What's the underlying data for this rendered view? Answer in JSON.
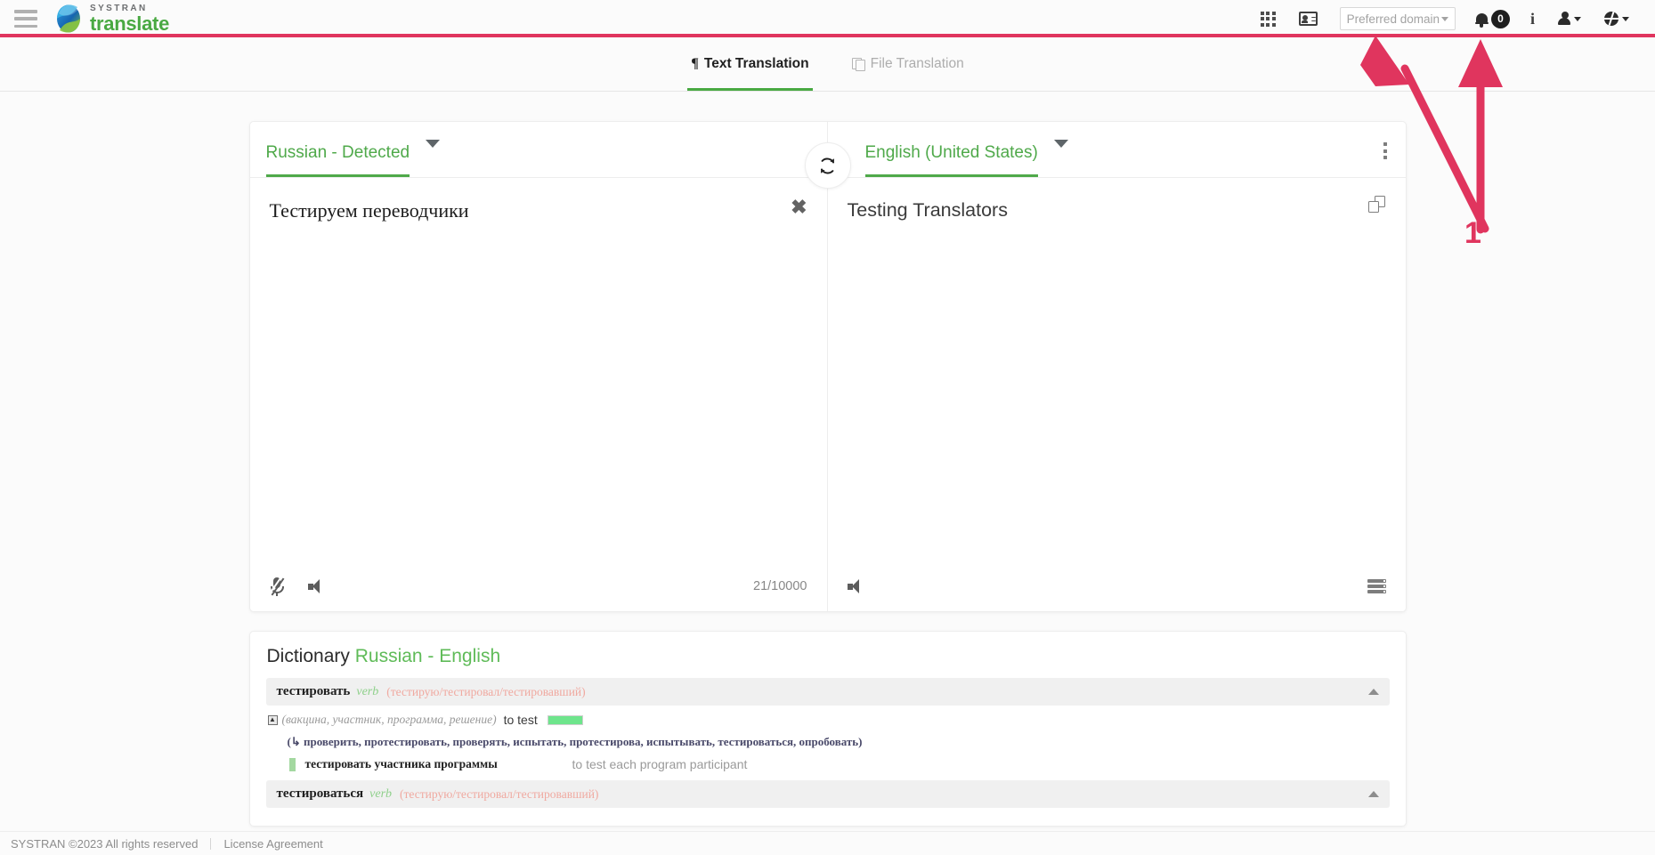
{
  "header": {
    "menu_icon": "hamburger-icon",
    "brand_top": "SYSTRAN",
    "brand_main": "translate",
    "apps_icon": "grid-apps-icon",
    "contact_icon": "contact-card-icon",
    "domain_label": "Preferred domain",
    "notifications_count": "0",
    "info_icon": "info-icon",
    "account_icon": "user-account-icon",
    "language_icon": "globe-language-icon"
  },
  "tabs": [
    {
      "label": "Text Translation",
      "icon": "pilcrow-icon",
      "active": true
    },
    {
      "label": "File Translation",
      "icon": "files-icon",
      "active": false
    }
  ],
  "translator": {
    "source": {
      "language": "Russian - Detected",
      "text": "Тестируем переводчики",
      "char_count": "21/10000",
      "clear_icon": "clear-x-icon",
      "mic_icon": "microphone-muted-icon",
      "speaker_icon": "speaker-icon"
    },
    "target": {
      "language": "English (United States)",
      "text": "Testing Translators",
      "copy_icon": "copy-icon",
      "speaker_icon": "speaker-icon",
      "align_icon": "alignment-icon"
    },
    "swap_icon": "swap-languages-icon",
    "options_icon": "kebab-menu-icon"
  },
  "dictionary": {
    "title": "Dictionary",
    "pair": "Russian - English",
    "entries": [
      {
        "word": "тестировать",
        "pos": "verb",
        "forms": "(тестирую/тестировал/тестировавший)",
        "collapse_icon": "chevron-up-icon",
        "expanded": true,
        "sense": {
          "context": "(вакцина, участник, программа, решение)",
          "translation": "to test",
          "meter": "green-confidence-bar",
          "synonyms": "(↳ проверить, протестировать, проверять, испытать, протестирова, испытывать, тестироваться, опробовать)",
          "example_source": "тестировать участника программы",
          "example_target": "to test each program participant"
        }
      },
      {
        "word": "тестироваться",
        "pos": "verb",
        "forms": "(тестирую/тестировал/тестировавший)",
        "collapse_icon": "chevron-up-icon",
        "expanded": false
      }
    ]
  },
  "annotation": {
    "number": "1",
    "color": "#e0355e"
  },
  "footer": {
    "copyright": "SYSTRAN ©2023 All rights reserved",
    "license": "License Agreement"
  },
  "colors": {
    "accent_pink": "#e0355e",
    "brand_green": "#49a942",
    "lang_green": "#4fa94a"
  }
}
